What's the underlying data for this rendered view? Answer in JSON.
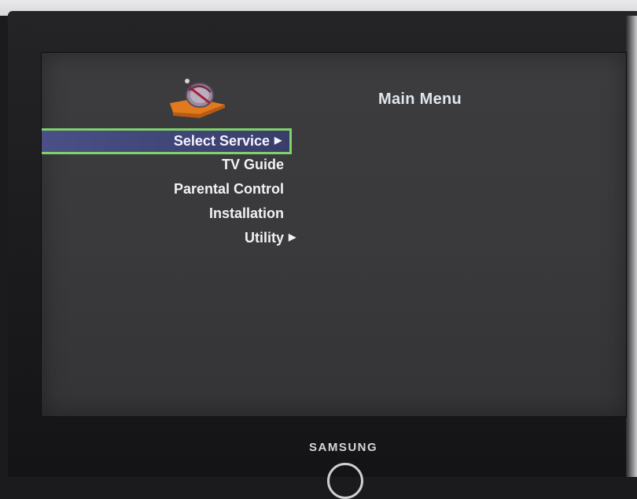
{
  "menu": {
    "title": "Main Menu",
    "items": [
      {
        "label": "Select Service",
        "arrow": "▶",
        "selected": true
      },
      {
        "label": "TV Guide",
        "arrow": "",
        "selected": false
      },
      {
        "label": "Parental Control",
        "arrow": "",
        "selected": false
      },
      {
        "label": "Installation",
        "arrow": "",
        "selected": false
      },
      {
        "label": "Utility",
        "arrow": "▶",
        "selected": false
      }
    ]
  },
  "device": {
    "brand": "SAMSUNG"
  },
  "colors": {
    "selection_bg": "#424779",
    "selection_border": "#7fd16a",
    "screen_bg": "#3a3a3c",
    "text": "#f2f2f2"
  },
  "icons": {
    "logo": "satellite-dish-icon",
    "submenu": "arrow-right-icon"
  }
}
